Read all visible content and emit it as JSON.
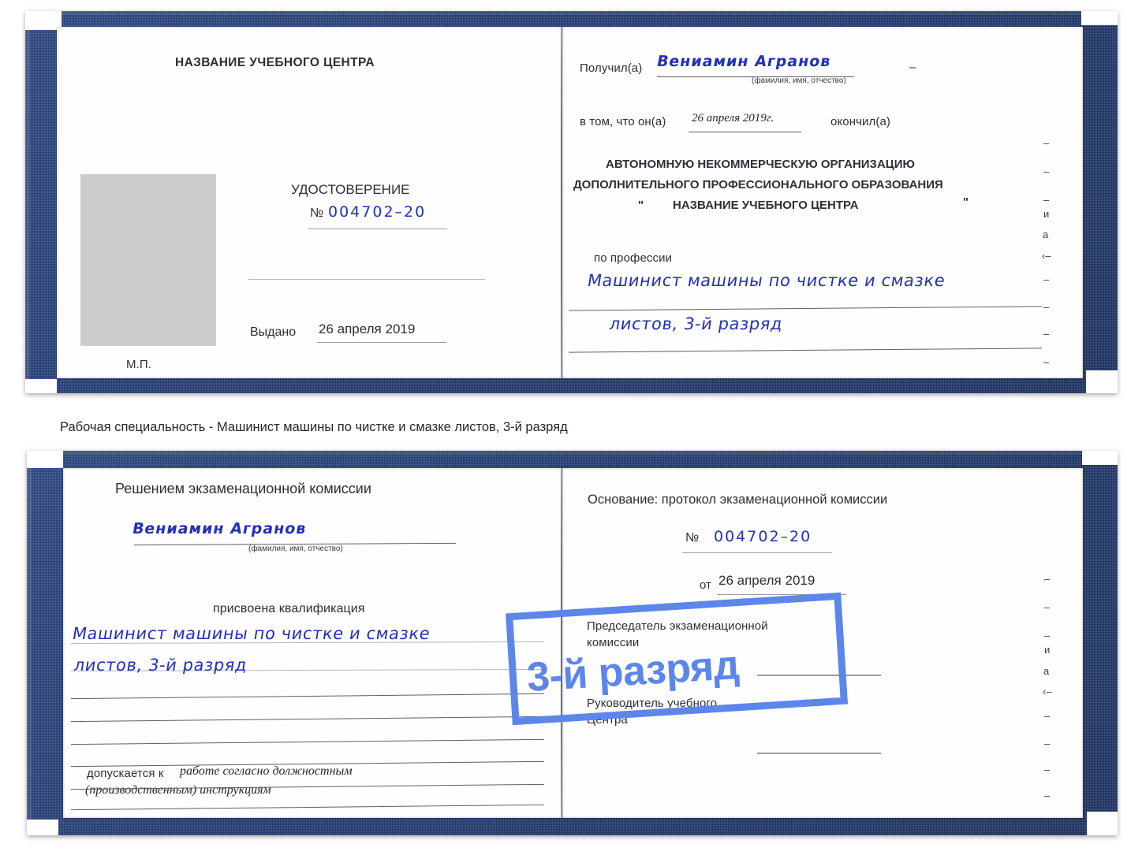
{
  "document": {
    "type": "certificate-scan",
    "caption": "Рабочая специальность - Машинист машины по чистке и смазке листов, 3-й разряд",
    "watermark": {
      "text": "3-й разряд",
      "color": "#5c86ea"
    },
    "cover_color": "#26407c",
    "ink_color": "#2230b8"
  },
  "cert_top": {
    "left": {
      "heading": "НАЗВАНИЕ УЧЕБНОГО ЦЕНТРА",
      "doc_title": "УДОСТОВЕРЕНИЕ",
      "number_label": "№",
      "number_value": "004702–20",
      "issued_label": "Выдано",
      "issued_value": "26 апреля 2019",
      "seal_label": "М.П."
    },
    "right": {
      "received_label": "Получил(а)",
      "received_value": "Вениамин Агранов",
      "fio_caption": "(фамилия, имя, отчество)",
      "that_label": "в том, что он(а)",
      "that_date": "26 апреля 2019г.",
      "finished_label": "окончил(а)",
      "org_line1": "АВТОНОМНУЮ НЕКОММЕРЧЕСКУЮ ОРГАНИЗАЦИЮ",
      "org_line2": "ДОПОЛНИТЕЛЬНОГО ПРОФЕССИОНАЛЬНОГО ОБРАЗОВАНИЯ",
      "org_quote_open": "\"",
      "org_name": "НАЗВАНИЕ УЧЕБНОГО ЦЕНТРА",
      "org_quote_close": "\"",
      "profession_label": "по профессии",
      "profession_line1": "Машинист машины по чистке и смазке",
      "profession_line2": "листов, 3-й разряд"
    },
    "edge_marks": [
      "–",
      "–",
      "–",
      "и",
      "а",
      "‹–",
      "–",
      "–",
      "–"
    ]
  },
  "cert_bottom": {
    "left": {
      "heading": "Решением экзаменационной комиссии",
      "name_value": "Вениамин Агранов",
      "fio_caption": "(фамилия, имя, отчество)",
      "qualification_label": "присвоена квалификация",
      "qualification_line1": "Машинист машины по чистке и смазке",
      "qualification_line2": "листов, 3-й разряд",
      "allowed_label": "допускается к",
      "allowed_value1": "работе согласно должностным",
      "allowed_value2": "(производственным) инструкциям"
    },
    "right": {
      "basis_label": "Основание: протокол экзаменационной комиссии",
      "number_label": "№",
      "number_value": "004702–20",
      "date_label": "от",
      "date_value": "26 апреля 2019",
      "chairman_line1": "Председатель экзаменационной",
      "chairman_line2": "комиссии",
      "head_line1": "Руководитель учебного",
      "head_line2": "Центра"
    },
    "edge_marks": [
      "–",
      "–",
      "–",
      "и",
      "а",
      "‹–",
      "–",
      "–",
      "–"
    ]
  }
}
